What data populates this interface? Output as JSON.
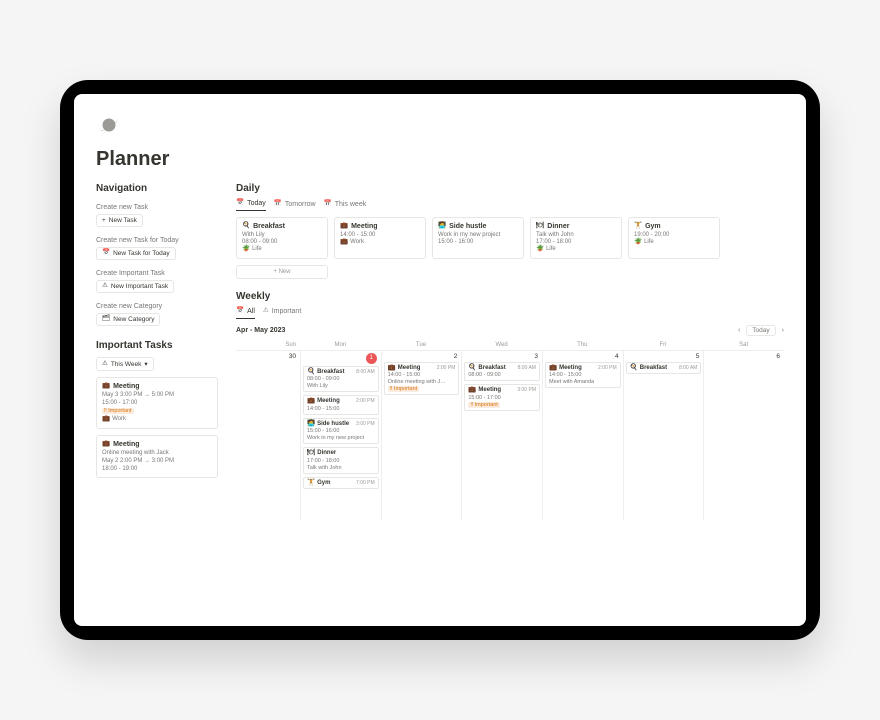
{
  "page": {
    "title": "Planner"
  },
  "sidebar": {
    "nav_heading": "Navigation",
    "groups": [
      {
        "label": "Create new Task",
        "button_icon": "+",
        "button": "New Task"
      },
      {
        "label": "Create new Task for Today",
        "button_icon": "📅",
        "button": "New Task for Today"
      },
      {
        "label": "Create Important Task",
        "button_icon": "⚠",
        "button": "New Important Task"
      },
      {
        "label": "Create new Category",
        "button_icon": "🗂",
        "button": "New Category"
      }
    ],
    "important": {
      "heading": "Important Tasks",
      "filter_icon": "⚠",
      "filter_label": "This Week",
      "filter_chevron": "▾",
      "tasks": [
        {
          "icon": "💼",
          "title": "Meeting",
          "when": "May 3 3:00 PM → 5:00 PM",
          "time": "15:00 - 17:00",
          "tag_icon": "‼",
          "tag": "Important",
          "cat_icon": "💼",
          "cat": "Work"
        },
        {
          "icon": "💼",
          "title": "Meeting",
          "subtitle": "Online meeting with Jack",
          "when": "May 2 2:00 PM → 3:00 PM",
          "time": "18:00 - 19:00"
        }
      ]
    }
  },
  "daily": {
    "heading": "Daily",
    "tabs": [
      {
        "icon": "📅",
        "label": "Today",
        "active": true
      },
      {
        "icon": "📅",
        "label": "Tomorrow",
        "active": false
      },
      {
        "icon": "📅",
        "label": "This week",
        "active": false
      }
    ],
    "cards": [
      {
        "icon": "🍳",
        "title": "Breakfast",
        "line1": "With Lily",
        "line2": "08:00 - 09:00",
        "cat_icon": "🪴",
        "cat": "Life"
      },
      {
        "icon": "💼",
        "title": "Meeting",
        "line1": "14:00 - 15:00",
        "cat_icon": "💼",
        "cat": "Work"
      },
      {
        "icon": "🧑‍💻",
        "title": "Side hustle",
        "line1": "Work in my new project",
        "line2": "15:00 - 16:00"
      },
      {
        "icon": "🍽",
        "title": "Dinner",
        "line1": "Talk with John",
        "line2": "17:00 - 18:00",
        "cat_icon": "🪴",
        "cat": "Life"
      },
      {
        "icon": "🏋",
        "title": "Gym",
        "line1": "19:00 - 20:00",
        "cat_icon": "🪴",
        "cat": "Life"
      }
    ],
    "new_label": "+  New"
  },
  "weekly": {
    "heading": "Weekly",
    "tabs": [
      {
        "icon": "📅",
        "label": "All",
        "active": true
      },
      {
        "icon": "⚠",
        "label": "Important",
        "active": false
      }
    ],
    "range": "Apr - May 2023",
    "today_label": "Today",
    "prev": "‹",
    "next": "›",
    "daynames": [
      "Sun",
      "Mon",
      "Tue",
      "Wed",
      "Thu",
      "Fri",
      "Sat"
    ],
    "days": [
      {
        "num": "30",
        "highlight": false,
        "events": []
      },
      {
        "num": "1",
        "highlight": true,
        "events": [
          {
            "icon": "🍳",
            "title": "Breakfast",
            "time": "8:00 AM",
            "l1": "08:00 - 09:00",
            "l2": "With Lily"
          },
          {
            "icon": "💼",
            "title": "Meeting",
            "time": "2:00 PM",
            "l1": "14:00 - 15:00"
          },
          {
            "icon": "🧑‍💻",
            "title": "Side hustle",
            "time": "3:00 PM",
            "l1": "15:00 - 16:00",
            "l2": "Work in my new project"
          },
          {
            "icon": "🍽",
            "title": "Dinner",
            "time": "",
            "l1": "17:00 - 18:00",
            "l2": "Talk with John"
          },
          {
            "icon": "🏋",
            "title": "Gym",
            "time": "7:00 PM"
          }
        ]
      },
      {
        "num": "2",
        "highlight": false,
        "events": [
          {
            "icon": "💼",
            "title": "Meeting",
            "time": "2:00 PM",
            "l1": "14:00 - 15:00",
            "l2": "Online meeting with J…",
            "tag": "Important"
          }
        ]
      },
      {
        "num": "3",
        "highlight": false,
        "events": [
          {
            "icon": "🍳",
            "title": "Breakfast",
            "time": "8:00 AM",
            "l1": "08:00 - 09:00"
          },
          {
            "icon": "💼",
            "title": "Meeting",
            "time": "3:00 PM",
            "l1": "15:00 - 17:00",
            "tag": "Important"
          }
        ]
      },
      {
        "num": "4",
        "highlight": false,
        "events": [
          {
            "icon": "💼",
            "title": "Meeting",
            "time": "2:00 PM",
            "l1": "14:00 - 15:00",
            "l2": "Meet with Amanda"
          }
        ]
      },
      {
        "num": "5",
        "highlight": false,
        "events": [
          {
            "icon": "🍳",
            "title": "Breakfast",
            "time": "8:00 AM"
          }
        ]
      },
      {
        "num": "6",
        "highlight": false,
        "events": []
      }
    ]
  }
}
